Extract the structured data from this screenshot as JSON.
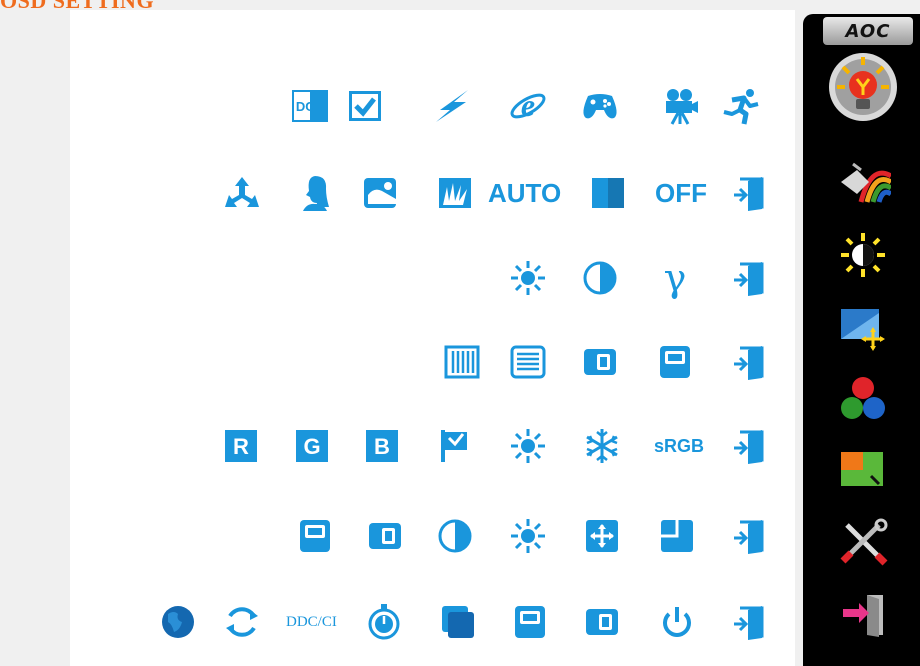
{
  "header": {
    "title": "OSD SETTING"
  },
  "colors": {
    "icon_blue": "#1a96dc",
    "title_orange": "#ef6c1e",
    "menu_bg": "#000000"
  },
  "sidebar": {
    "brand": "AOC",
    "items": [
      {
        "icon": "luminance-bulb-icon",
        "selected": true
      },
      {
        "icon": "image-setup-paint-icon"
      },
      {
        "icon": "picture-boost-brightness-icon"
      },
      {
        "icon": "display-position-icon"
      },
      {
        "icon": "color-setup-rgb-icon"
      },
      {
        "icon": "osd-setup-icon"
      },
      {
        "icon": "extra-tools-icon"
      },
      {
        "icon": "exit-door-icon"
      }
    ]
  },
  "rows": [
    {
      "icons": [
        "dcr-icon",
        "checkbox-icon",
        "lightning-icon",
        "internet-explorer-icon",
        "gamepad-icon",
        "video-camera-icon",
        "running-man-icon"
      ],
      "labels": {
        "dcr": "DCR"
      }
    },
    {
      "icons": [
        "tri-arrows-icon",
        "woman-profile-icon",
        "landscape-icon",
        "grass-icon",
        "auto-icon",
        "half-square-icon",
        "off-icon",
        "exit-icon"
      ],
      "labels": {
        "auto": "AUTO",
        "off": "OFF"
      }
    },
    {
      "icons": [
        "brightness-icon",
        "contrast-icon",
        "gamma-icon",
        "exit-icon"
      ],
      "labels": {
        "gamma": "γ"
      }
    },
    {
      "icons": [
        "vertical-lines-icon",
        "horizontal-lines-icon",
        "h-position-icon",
        "v-position-icon",
        "exit-icon"
      ]
    },
    {
      "icons": [
        "red-icon",
        "green-icon",
        "blue-icon",
        "flag-icon",
        "warm-sun-icon",
        "snowflake-icon",
        "srgb-icon",
        "exit-icon"
      ],
      "labels": {
        "r": "R",
        "g": "G",
        "b": "B",
        "srgb": "sRGB"
      }
    },
    {
      "icons": [
        "v-position-icon",
        "h-position-icon",
        "contrast-icon",
        "brightness-icon",
        "move-icon",
        "corner-square-icon",
        "exit-icon"
      ]
    },
    {
      "icons": [
        "globe-icon",
        "refresh-icon",
        "ddc-ci-icon",
        "timer-icon",
        "overlap-squares-icon",
        "v-position-icon",
        "h-position-icon",
        "power-icon",
        "exit-icon"
      ],
      "labels": {
        "ddcci": "DDC/CI"
      }
    }
  ]
}
